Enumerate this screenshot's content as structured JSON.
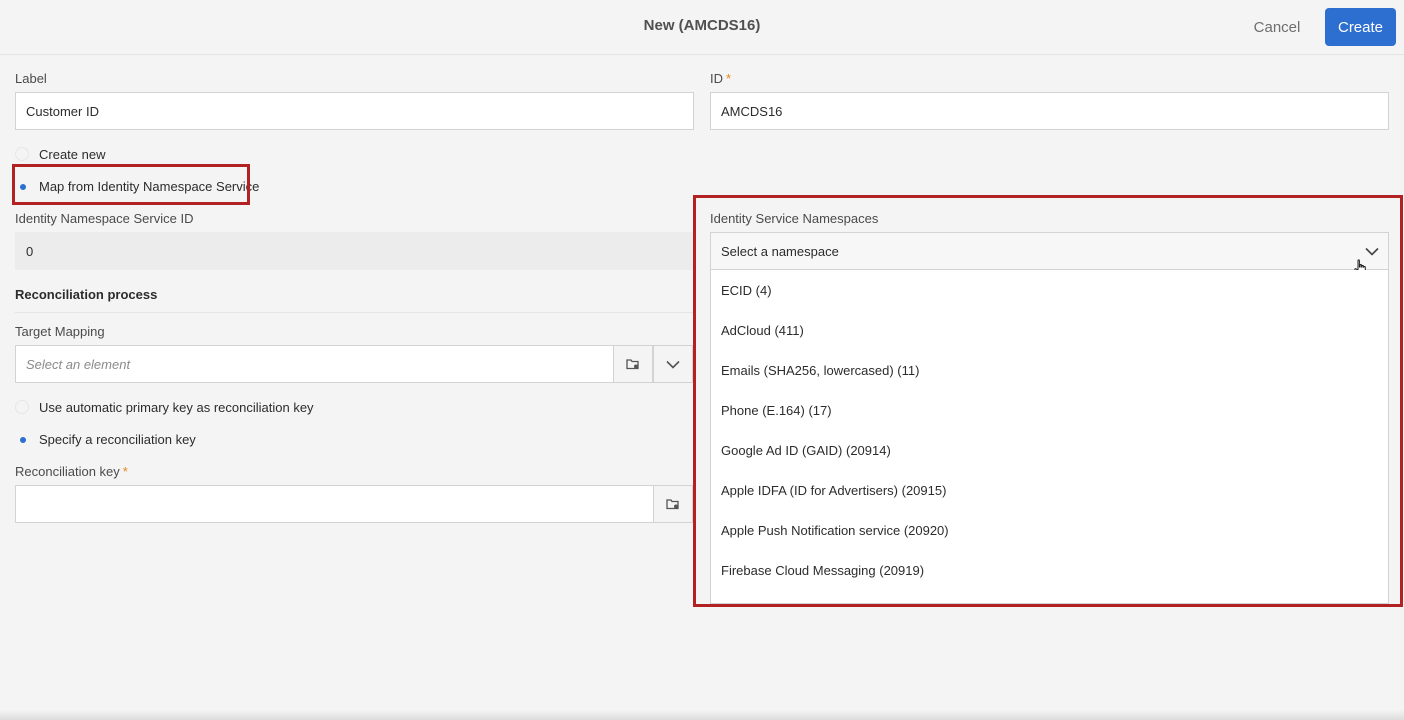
{
  "header": {
    "title": "New (AMCDS16)",
    "cancel_label": "Cancel",
    "create_label": "Create"
  },
  "form": {
    "label_label": "Label",
    "label_value": "Customer ID",
    "id_label": "ID",
    "id_required_mark": "*",
    "id_value": "AMCDS16",
    "radio_create_new": "Create new",
    "radio_map_from": "Map from Identity Namespace Service",
    "ins_id_label": "Identity Namespace Service ID",
    "ins_id_value": "0"
  },
  "reconciliation": {
    "section_title": "Reconciliation process",
    "target_mapping_label": "Target Mapping",
    "target_mapping_placeholder": "Select an element",
    "radio_auto_key": "Use automatic primary key as reconciliation key",
    "radio_specify_key": "Specify a reconciliation key",
    "key_label": "Reconciliation key",
    "key_required_mark": "*",
    "key_value": ""
  },
  "namespaces": {
    "label": "Identity Service Namespaces",
    "placeholder": "Select a namespace",
    "options": [
      "ECID (4)",
      "AdCloud (411)",
      "Emails (SHA256, lowercased) (11)",
      "Phone (E.164) (17)",
      "Google Ad ID (GAID) (20914)",
      "Apple IDFA (ID for Advertisers) (20915)",
      "Apple Push Notification service (20920)",
      "Firebase Cloud Messaging (20919)"
    ]
  },
  "colors": {
    "accent": "#2d6fd0",
    "highlight": "#b22222",
    "required": "#e68619"
  },
  "icons": {
    "chevron": "chevron-down-icon",
    "browse": "folder-browse-icon",
    "cursor": "hand-pointer-icon"
  }
}
